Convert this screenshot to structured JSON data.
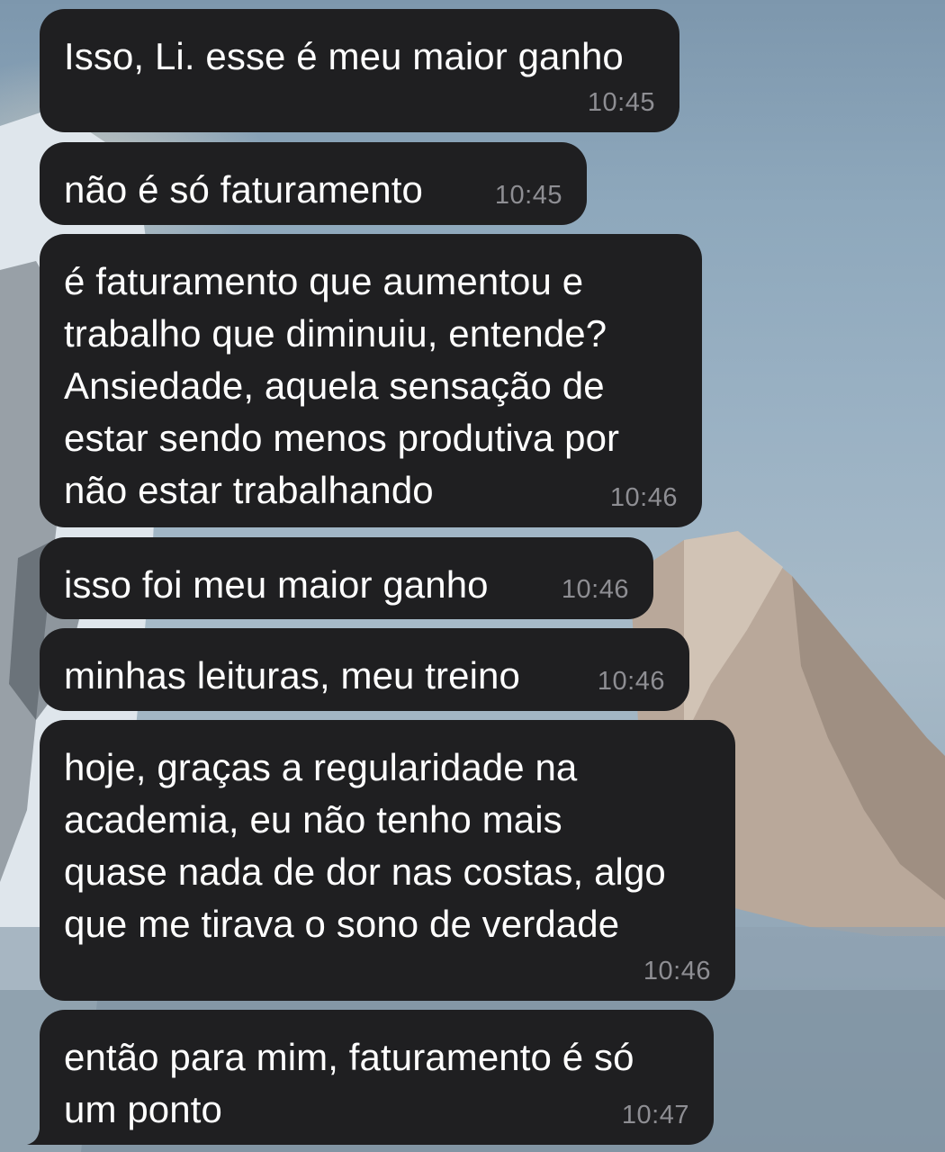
{
  "messages": [
    {
      "text": "Isso, Li. esse é meu maior ganho",
      "time": "10:45"
    },
    {
      "text": "não é só faturamento",
      "time": "10:45"
    },
    {
      "text": "é faturamento que aumentou e\ntrabalho que diminuiu, entende?\nAnsiedade, aquela sensação de\nestar sendo menos produtiva por\nnão estar trabalhando",
      "time": "10:46"
    },
    {
      "text": "isso foi meu maior ganho",
      "time": "10:46"
    },
    {
      "text": "minhas leituras, meu treino",
      "time": "10:46"
    },
    {
      "text": "hoje, graças a regularidade na\nacademia, eu não tenho mais\nquase nada de dor nas costas, algo\nque me tirava o sono de verdade",
      "time": "10:46"
    },
    {
      "text": "então para mim, faturamento é só\num ponto",
      "time": "10:47"
    }
  ],
  "colors": {
    "bubble": "#1f1f21",
    "text": "#ffffff",
    "time": "#8e8e93"
  }
}
